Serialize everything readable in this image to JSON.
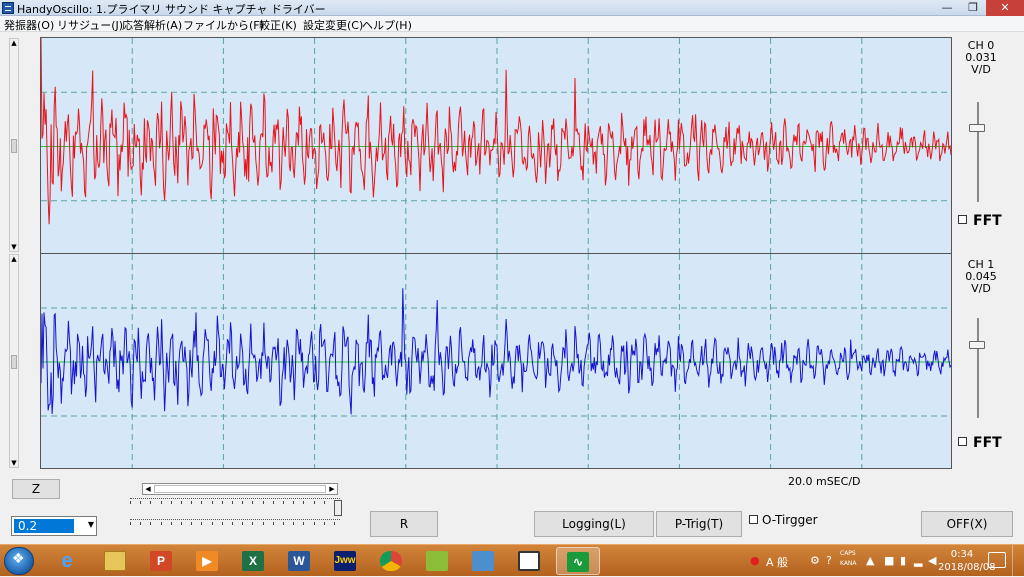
{
  "window": {
    "title": "HandyOscillo:  1.プライマリ サウンド キャプチャ ドライバー",
    "minimize": "—",
    "maximize": "❐",
    "close": "✕"
  },
  "menu": {
    "items": [
      "発振器(O)",
      "リサジュー(J)",
      "応答解析(A)",
      "ファイルから(F)",
      "較正(K)",
      "設定変更(C)",
      "ヘルプ(H)"
    ]
  },
  "channels": [
    {
      "name": "CH 0",
      "scale": "0.031",
      "unit": "V/D",
      "fft_label": "FFT",
      "fft_checked": false,
      "color": "#e8141c"
    },
    {
      "name": "CH 1",
      "scale": "0.045",
      "unit": "V/D",
      "fft_label": "FFT",
      "fft_checked": false,
      "color": "#1414d0"
    }
  ],
  "plot_colors": {
    "background": "#d6e8f7",
    "grid": "#5aa59f",
    "zero_line": "#27c43a"
  },
  "controls": {
    "z_button": "Z",
    "zoom_value": "0.2",
    "time_div": "20.0  mSEC/D",
    "r_button": "R",
    "logging_button": "Logging(L)",
    "ptrig_button": "P-Trig(T)",
    "otrigger_label": "O-Tirgger",
    "otrigger_checked": false,
    "off_button": "OFF(X)"
  },
  "taskbar": {
    "apps": [
      "ie-icon",
      "explorer-icon",
      "powerpoint-icon",
      "media-player-icon",
      "excel-icon",
      "word-icon",
      "jww-icon",
      "chrome-icon",
      "app-leaf-icon",
      "network-app-icon",
      "package-icon",
      "handyoscillo-icon"
    ],
    "active_app": "handyoscillo-icon",
    "ime": "A 般",
    "caps": "CAPS",
    "kana": "KANA",
    "time": "0:34",
    "date": "2018/08/08"
  }
}
